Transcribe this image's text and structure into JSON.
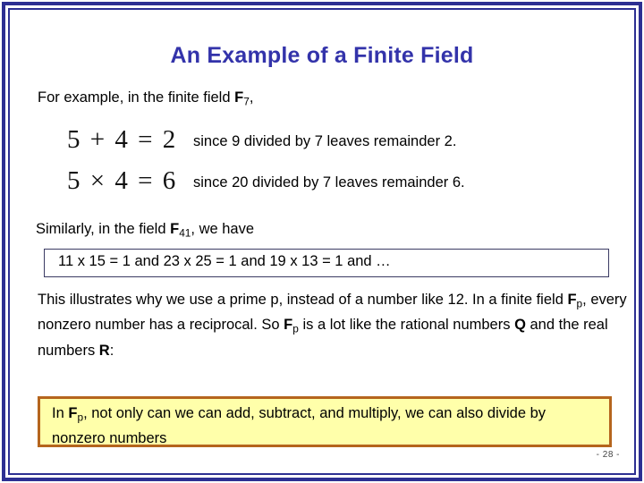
{
  "slide": {
    "title": "An Example of a Finite Field",
    "title_color": "#3333aa",
    "frame_color": "#2d2f92",
    "background_color": "#ffffff",
    "page_number": "- 28 -"
  },
  "intro": {
    "prefix": "For example, in the finite field ",
    "field_symbol": "F",
    "field_subscript": "7",
    "suffix": ","
  },
  "equations": [
    {
      "expression": "5 + 4 = 2",
      "note": "since 9 divided by 7 leaves remainder 2."
    },
    {
      "expression": "5 × 4 = 6",
      "note": "since 20 divided by 7 leaves remainder 6."
    }
  ],
  "similarly": {
    "prefix": "Similarly, in the field ",
    "field_symbol": "F",
    "field_subscript": "41",
    "suffix": ", we have"
  },
  "white_box": {
    "text": "11 x 15 = 1  and  23 x 25 = 1  and  19 x 13 = 1 and …",
    "border_color": "#3b3b63",
    "fill_color": "#ffffff"
  },
  "paragraph": {
    "part1": "This illustrates why we use a prime p, instead of a number like 12. In a finite field ",
    "field_symbol_1": "F",
    "field_subscript_1": "p",
    "part2": ", every nonzero number has a reciprocal. So ",
    "field_symbol_2": "F",
    "field_subscript_2": "p",
    "part3": " is a lot like the rational numbers ",
    "rationals_symbol": "Q",
    "part4": " and the real numbers ",
    "reals_symbol": "R",
    "part5": ":"
  },
  "yellow_box": {
    "prefix": "In ",
    "field_symbol": "F",
    "field_subscript": "p",
    "text": ", not only can we can add, subtract, and multiply, we can also divide by nonzero numbers",
    "border_color": "#b5651d",
    "fill_color": "#ffffaa"
  }
}
